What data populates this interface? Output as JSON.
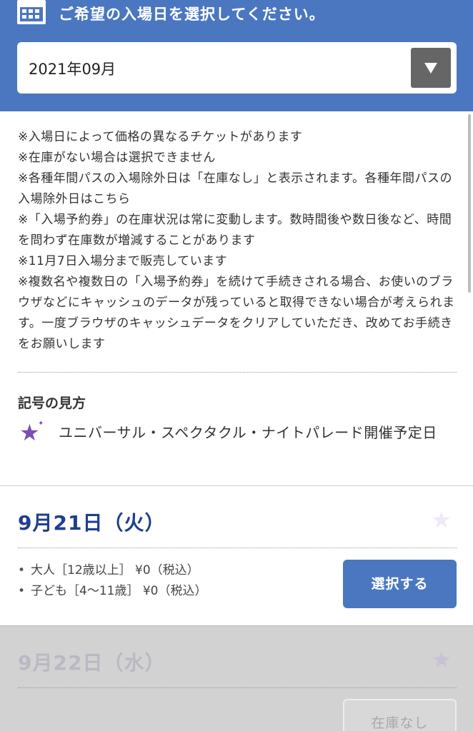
{
  "header": {
    "icon": "calendar-icon",
    "title": "ご希望の入場日を選択してください。",
    "month_select": {
      "value": "2021年09月",
      "icon": "triangle-down-icon"
    }
  },
  "notes": [
    "※入場日によって価格の異なるチケットがあります",
    "※在庫がない場合は選択できません",
    "※各種年間パスの入場除外日は「在庫なし」と表示されます。各種年間パスの入場除外日はこちら",
    "※「入場予約券」の在庫状況は常に変動します。数時間後や数日後など、時間を問わず在庫数が増減することがあります",
    "※11月7日入場分まで販売しています",
    "※複数名や複数日の「入場予約券」を続けて手続きされる場合、お使いのブラウザなどにキャッシュのデータが残っていると取得できない場合が考えられます。一度ブラウザのキャッシュデータをクリアしていただき、改めてお手続きをお願いします"
  ],
  "legend": {
    "title": "記号の見方",
    "icon": "purple-star-icon",
    "text": "ユニバーサル・スペクタクル・ナイトパレード開催予定日"
  },
  "dates": [
    {
      "date": "9月21日（火）",
      "prices": [
        "大人［12歳以上］ ¥0（税込）",
        "子ども［4〜11歳］ ¥0（税込）"
      ],
      "button": "選択する",
      "available": true
    },
    {
      "date": "9月22日（水）",
      "button": "在庫なし",
      "available": false
    }
  ],
  "colors": {
    "header_bg": "#4a77c0",
    "date_text": "#1f3f8f",
    "star": "#7b4fb0",
    "select_button": "#4a77c0",
    "soldout_bg": "#d2d2d2"
  }
}
